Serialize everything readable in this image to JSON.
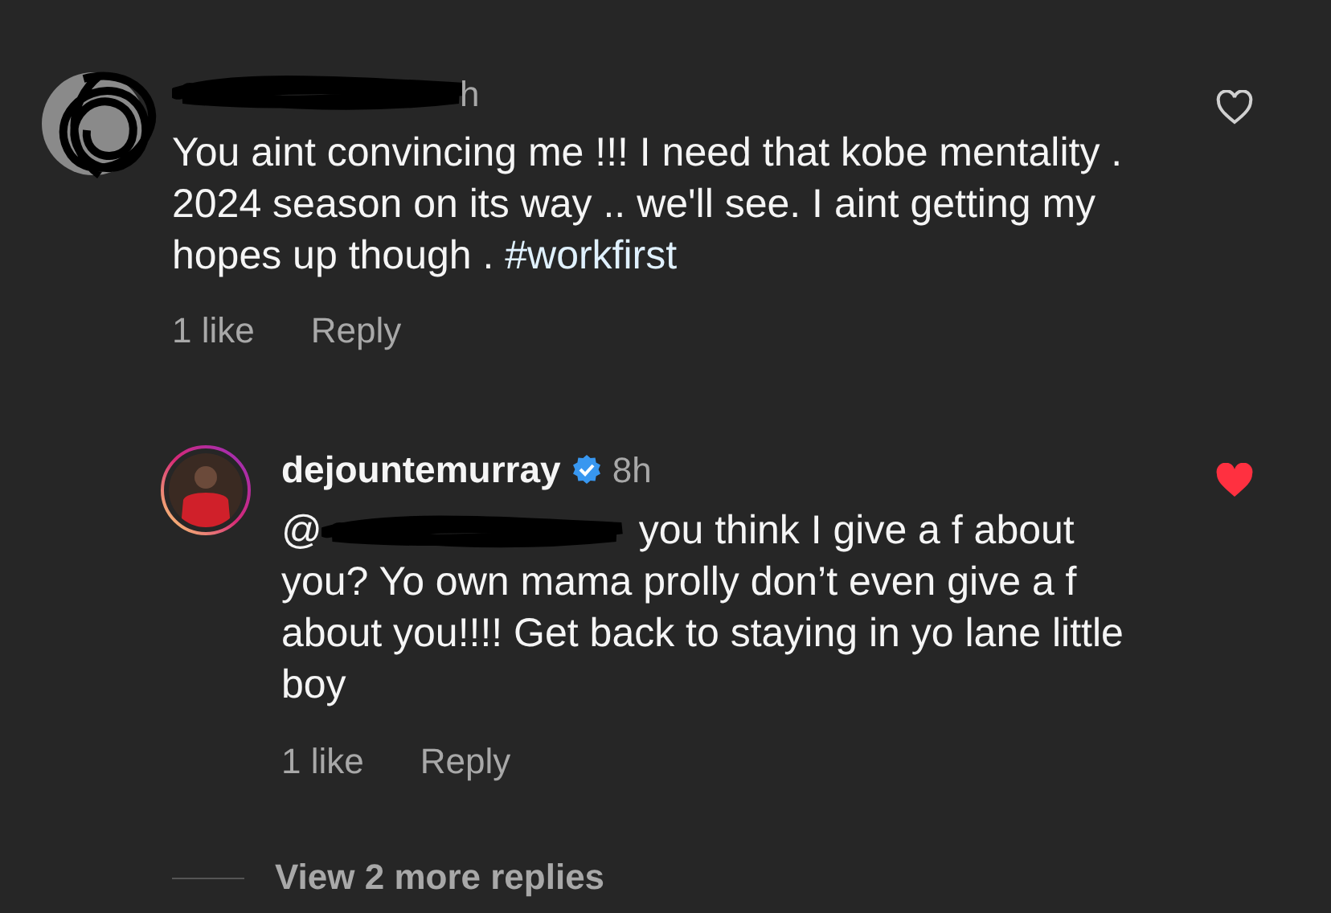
{
  "comment": {
    "time": "h",
    "text": "You aint convincing me !!! I need that kobe mentality . 2024 season on its way .. we'll see. I aint getting my hopes up though .",
    "hashtag": "#workfirst",
    "likes": "1 like",
    "reply": "Reply",
    "liked": false,
    "replies": [
      {
        "username": "dejountemurray",
        "verified": true,
        "time": "8h",
        "mention": "@",
        "text": "you think I give a f about you? Yo own mama prolly don’t even give a f about you!!!! Get back to staying in yo lane little boy",
        "likes": "1 like",
        "reply": "Reply",
        "liked": true
      }
    ],
    "more_replies": "View 2 more replies"
  }
}
